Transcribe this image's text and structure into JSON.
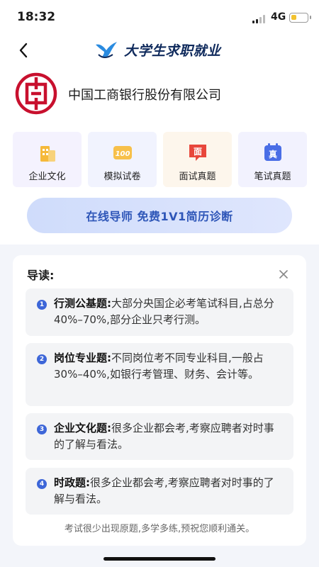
{
  "status_bar": {
    "time": "18:32",
    "network": "4G",
    "battery_level": 0.35
  },
  "nav": {
    "back_icon": "chevron-left-icon",
    "brand_title": "大学生求职就业",
    "brand_logo": "bird-logo"
  },
  "company": {
    "name": "中国工商银行股份有限公司",
    "logo": "icbc-logo"
  },
  "features": [
    {
      "label": "企业文化",
      "icon": "building-icon"
    },
    {
      "label": "模拟试卷",
      "icon": "score-100-icon"
    },
    {
      "label": "面试真题",
      "icon": "interview-chat-icon"
    },
    {
      "label": "笔试真题",
      "icon": "calendar-zhen-icon"
    }
  ],
  "banner": {
    "text": "在线导师  免费1V1简历诊断"
  },
  "guide": {
    "title": "导读:",
    "items": [
      {
        "num": "1",
        "bold": "行测公基题:",
        "text": "大部分央国企必考笔试科目,占总分40%–70%,部分企业只考行测。"
      },
      {
        "num": "2",
        "bold": "岗位专业题:",
        "text": "不同岗位考不同专业科目,一般占30%–40%,如银行考管理、财务、会计等。"
      },
      {
        "num": "3",
        "bold": "企业文化题:",
        "text": "很多企业都会考,考察应聘者对时事的了解与看法。"
      },
      {
        "num": "4",
        "bold": "时政题:",
        "text": "很多企业都会考,考察应聘者对时事的了解与看法。"
      }
    ],
    "footer": "考试很少出现原题,多学多练,预祝您顺利通关。"
  },
  "colors": {
    "accent": "#3d66d8",
    "brand_navy": "#0f2a5c",
    "icbc_red": "#c8102e"
  }
}
